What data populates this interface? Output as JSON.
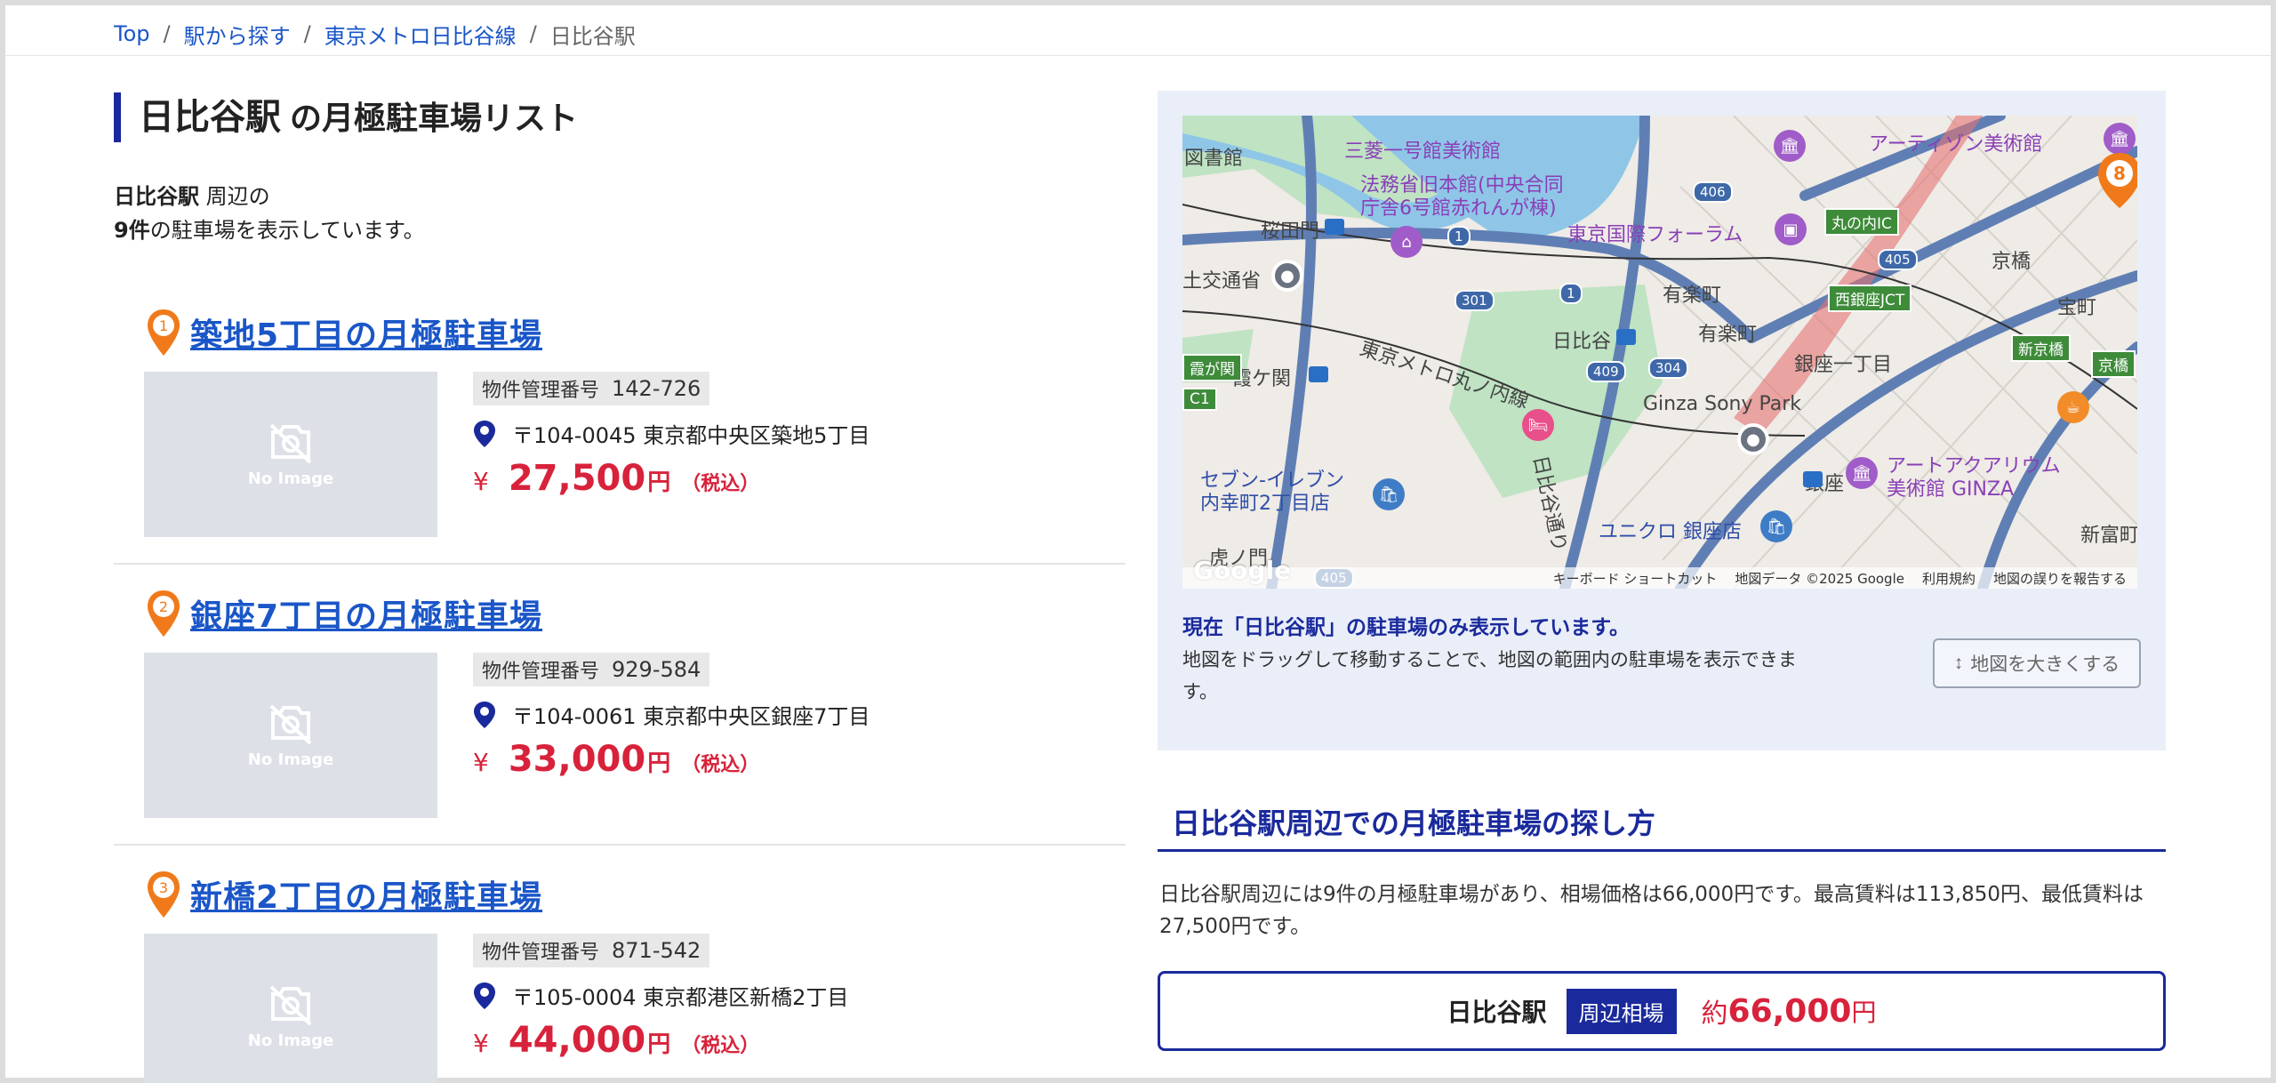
{
  "breadcrumb": {
    "items": [
      "Top",
      "駅から探す",
      "東京メトロ日比谷線"
    ],
    "current": "日比谷駅"
  },
  "header": {
    "station": "日比谷駅",
    "title_suffix": "の月極駐車場リスト"
  },
  "summary": {
    "station": "日比谷駅",
    "line1_suffix": " 周辺の",
    "count": "9件",
    "line2_suffix": "の駐車場を表示しています。"
  },
  "listings": [
    {
      "rank": "1",
      "name": "築地5丁目の月極駐車場",
      "mgmt_label": "物件管理番号",
      "mgmt_number": "142-726",
      "address": "〒104-0045 東京都中央区築地5丁目",
      "yen": "¥",
      "price": "27,500",
      "unit": "円",
      "tax": "（税込）",
      "image_label": "No Image"
    },
    {
      "rank": "2",
      "name": "銀座7丁目の月極駐車場",
      "mgmt_label": "物件管理番号",
      "mgmt_number": "929-584",
      "address": "〒104-0061 東京都中央区銀座7丁目",
      "yen": "¥",
      "price": "33,000",
      "unit": "円",
      "tax": "（税込）",
      "image_label": "No Image"
    },
    {
      "rank": "3",
      "name": "新橋2丁目の月極駐車場",
      "mgmt_label": "物件管理番号",
      "mgmt_number": "871-542",
      "address": "〒105-0004 東京都港区新橋2丁目",
      "yen": "¥",
      "price": "44,000",
      "unit": "円",
      "tax": "（税込）",
      "image_label": "No Image"
    }
  ],
  "map": {
    "labels": {
      "mitsubishi": "三菱一号館美術館",
      "artizon": "アーティゾン美術館",
      "ministry": "法務省旧本館(中央合同\n庁舎6号館赤れんが棟)",
      "forum": "東京国際フォーラム",
      "sakuradamon": "桜田門",
      "yurakucho1": "有楽町",
      "yurakucho2": "有楽町",
      "hibiya": "日比谷",
      "ginza1": "銀座一丁目",
      "kyobashi": "京橋",
      "takaracho": "宝町",
      "kasumigaseki": "霞ケ関",
      "marunouchi_line": "東京メトロ丸ノ内線",
      "sony_park": "Ginza Sony Park",
      "ginza": "銀座",
      "seven": "セブン-イレブン\n内幸町2丁目店",
      "uniqlo": "ユニクロ 銀座店",
      "aqua": "アートアクアリウム\n美術館 GINZA",
      "shintomicho": "新富町",
      "toshokan": "図書館",
      "kotsu": "土交通省",
      "toranomon": "虎ノ門",
      "hibiya_street": "日比谷通り"
    },
    "signs": {
      "marunouchi_ic": "丸の内IC",
      "nishiginza_jct": "西銀座JCT",
      "shinkyobashi": "新京橋",
      "kyobashi_sign": "京橋",
      "c1": "C1",
      "kasumigaseki_sign": "霞が関"
    },
    "routes": [
      "406",
      "405",
      "301",
      "409",
      "304",
      "405",
      "1",
      "1"
    ],
    "marker_number": "8",
    "google": "Google",
    "footer": [
      "キーボード ショートカット",
      "地図データ ©2025 Google",
      "利用規約",
      "地図の誤りを報告する"
    ]
  },
  "map_note": {
    "title": "現在「日比谷駅」の駐車場のみ表示しています。",
    "body": "地図をドラッグして移動することで、地図の範囲内の駐車場を表示できます。",
    "expand_button": "地図を大きくする",
    "expand_icon": "↕"
  },
  "section": {
    "title": "日比谷駅周辺での月極駐車場の探し方",
    "body": "日比谷駅周辺には9件の月極駐車場があり、相場価格は66,000円です。最高賃料は113,850円、最低賃料は27,500円です。"
  },
  "market": {
    "station": "日比谷駅",
    "badge": "周辺相場",
    "approx": "約",
    "amount": "66,000",
    "unit": "円"
  },
  "colors": {
    "accent": "#1a2a9c",
    "link": "#1a56c8",
    "price": "#d8223b",
    "pin": "#f07a1a"
  }
}
